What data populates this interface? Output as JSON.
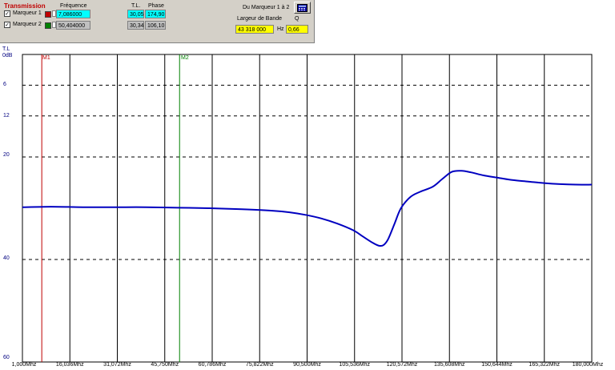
{
  "panel": {
    "title": "Transmission",
    "col_frequence": "Fréquence",
    "col_tl": "T.L.",
    "col_phase": "Phase",
    "markers": [
      {
        "label": "Marqueur 1",
        "checked": "✓",
        "color": "#c00000",
        "frequency": "7,086000",
        "tl": "30,05",
        "phase": "174,90"
      },
      {
        "label": "Marqueur 2",
        "checked": "✓",
        "color": "#008000",
        "frequency": "50,404000",
        "tl": "30,34",
        "phase": "106,10"
      }
    ],
    "du_marqueur": "Du Marqueur 1 à 2",
    "largeur_label": "Largeur de Bande",
    "q_label": "Q",
    "bandwidth": "43 318 000",
    "hz": "Hz",
    "q_value": "0,66",
    "calc_icon": "calculator-icon"
  },
  "chart_data": {
    "type": "line",
    "ylabel": "T.L",
    "yunit": "0dB",
    "y_ticks": [
      "6",
      "12",
      "20",
      "40",
      "60"
    ],
    "x_ticks": [
      "1,000Mhz",
      "16,036Mhz",
      "31,072Mhz",
      "45,750Mhz",
      "60,786Mhz",
      "75,822Mhz",
      "90,500Mhz",
      "105,536Mhz",
      "120,572Mhz",
      "135,608Mhz",
      "150,644Mhz",
      "165,322Mhz",
      "180,000Mhz"
    ],
    "markers": [
      {
        "name": "M1",
        "x": 7.086,
        "color": "#c00000"
      },
      {
        "name": "M2",
        "x": 50.404,
        "color": "#008000"
      }
    ],
    "colors": {
      "trace": "#0000c0",
      "grid": "#000000"
    },
    "series": [
      {
        "x": [
          1,
          10,
          20,
          30,
          40,
          50,
          60,
          70,
          80,
          85,
          90,
          95,
          100,
          105,
          108,
          111,
          113,
          114.5,
          116,
          118,
          120,
          123,
          126,
          130,
          133,
          136,
          139,
          142,
          146,
          150,
          155,
          160,
          165,
          170,
          175,
          180
        ],
        "y": [
          29.8,
          29.7,
          29.8,
          29.8,
          29.8,
          29.9,
          30.0,
          30.2,
          30.5,
          30.8,
          31.3,
          32.0,
          33.0,
          34.3,
          35.5,
          36.7,
          37.3,
          37.2,
          36.0,
          33.0,
          30.0,
          27.8,
          26.8,
          25.8,
          24.3,
          22.9,
          22.7,
          23.0,
          23.6,
          24.0,
          24.5,
          24.8,
          25.1,
          25.3,
          25.4,
          25.4
        ]
      }
    ]
  }
}
